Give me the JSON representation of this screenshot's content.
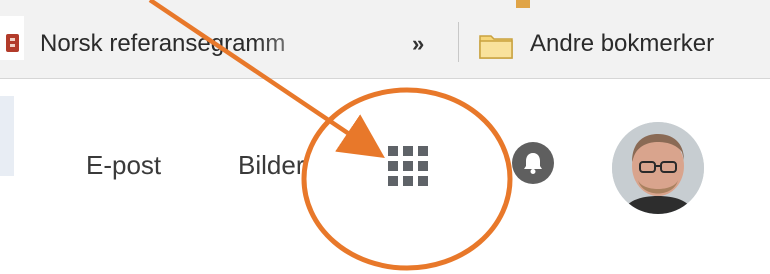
{
  "bookmarks_bar": {
    "site_bookmark_label": "Norsk referansegramm",
    "overflow_chevron": "»",
    "folder_label": "Andre bokmerker",
    "folder_icon": "folder-icon"
  },
  "header": {
    "email_link": "E-post",
    "images_link": "Bilder",
    "apps_icon": "apps-grid-icon",
    "notifications_icon": "bell-icon",
    "avatar_alt": "avatar"
  },
  "annotation": {
    "color": "#E8782A"
  }
}
